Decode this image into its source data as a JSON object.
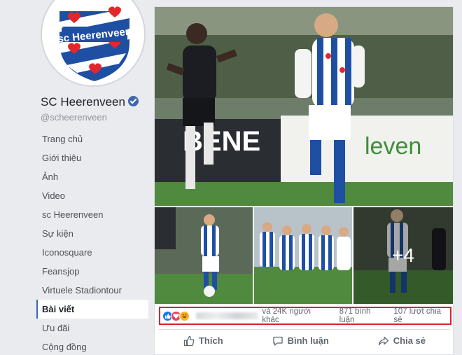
{
  "page": {
    "name": "SC Heerenveen",
    "handle": "@scheerenveen",
    "logo_text": "sc Heerenveen"
  },
  "nav": {
    "items": [
      {
        "label": "Trang chủ",
        "active": false
      },
      {
        "label": "Giới thiệu",
        "active": false
      },
      {
        "label": "Ảnh",
        "active": false
      },
      {
        "label": "Video",
        "active": false
      },
      {
        "label": "sc Heerenveen",
        "active": false
      },
      {
        "label": "Sự kiện",
        "active": false
      },
      {
        "label": "Iconosquare",
        "active": false
      },
      {
        "label": "Feansjop",
        "active": false
      },
      {
        "label": "Virtuele Stadiontour",
        "active": false
      },
      {
        "label": "Bài viết",
        "active": true
      },
      {
        "label": "Ưu đãi",
        "active": false
      },
      {
        "label": "Cộng đồng",
        "active": false
      }
    ]
  },
  "post": {
    "more_photos": "+4",
    "reactions": {
      "icons": [
        "like-icon",
        "love-icon",
        "haha-icon"
      ],
      "others_text": "và 24K người khác",
      "comments": "871 bình luận",
      "shares": "107 lượt chia sẻ"
    },
    "actions": {
      "like": "Thích",
      "comment": "Bình luận",
      "share": "Chia sẻ"
    }
  },
  "colors": {
    "accent": "#4267b2",
    "highlight_box": "#e0202a",
    "club_blue": "#1f4fa3",
    "heart_red": "#e3262d"
  }
}
